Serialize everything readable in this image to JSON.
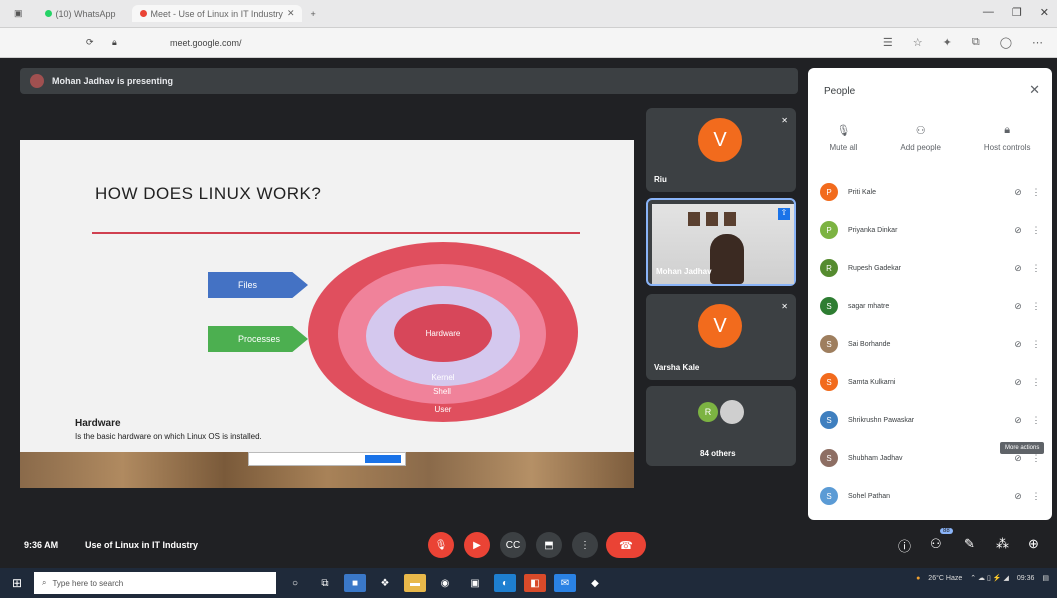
{
  "browser": {
    "tabs": [
      "(10) WhatsApp",
      "Meet - Use of Linux in IT Industry"
    ],
    "address_url": "meet.google.com/",
    "window_controls": [
      "—",
      "❐",
      "✕"
    ]
  },
  "meet": {
    "presenting_text": "Mohan Jadhav is presenting",
    "slide": {
      "title": "HOW DOES LINUX WORK?",
      "arrow_files": "Files",
      "arrow_processes": "Processes",
      "layers": [
        "User",
        "Shell",
        "Kernel",
        "Hardware"
      ],
      "hardware_heading": "Hardware",
      "hardware_desc": "Is the basic hardware on which Linux OS is installed."
    },
    "tiles": [
      {
        "name": "Riu",
        "initial": "V"
      },
      {
        "name": "Mohan Jadhav",
        "initial": ""
      },
      {
        "name": "Varsha Kale",
        "initial": "V"
      },
      {
        "name": "84 others",
        "initial": "R"
      }
    ],
    "people_panel": {
      "title": "People",
      "actions": [
        "Mute all",
        "Add people",
        "Host controls"
      ],
      "people": [
        {
          "name": "Priti Kale",
          "initial": "P",
          "color": "#f26b1d"
        },
        {
          "name": "Priyanka Dinkar",
          "initial": "P",
          "color": "#7cb342"
        },
        {
          "name": "Rupesh Gadekar",
          "initial": "R",
          "color": "#558b2f"
        },
        {
          "name": "sagar mhatre",
          "initial": "S",
          "color": "#2e7d32"
        },
        {
          "name": "Sai Borhande",
          "initial": "S",
          "color": "#9e7e5e"
        },
        {
          "name": "Samta Kulkarni",
          "initial": "S",
          "color": "#f26b1d"
        },
        {
          "name": "Shrikrushn Pawaskar",
          "initial": "S",
          "color": "#3f7fbf"
        },
        {
          "name": "Shubham Jadhav",
          "initial": "S",
          "color": "#8d6e63"
        },
        {
          "name": "Sohel Pathan",
          "initial": "S",
          "color": "#5b9bd5"
        }
      ],
      "tooltip": "More actions"
    },
    "bottom": {
      "time": "9:36 AM",
      "meeting_title": "Use of Linux in IT Industry",
      "participant_count": "88"
    }
  },
  "taskbar": {
    "search_placeholder": "Type here to search",
    "tray_text": "26°C Haze",
    "clock": "09:36"
  },
  "colors": {
    "meet_bg": "#202124",
    "tile_bg": "#3c4043",
    "leave_red": "#ea4335",
    "avatar_orange": "#f26b1d"
  }
}
